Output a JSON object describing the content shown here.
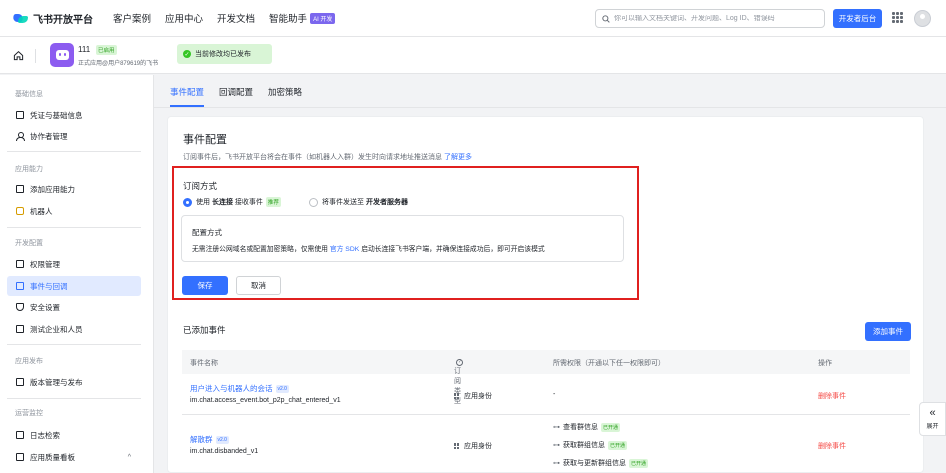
{
  "topbar": {
    "logo_text": "飞书开放平台",
    "nav": [
      "客户案例",
      "应用中心",
      "开发文档",
      "智能助手"
    ],
    "ai_badge": "AI 开发",
    "search_placeholder": "你可以输入文档关键词、开发问题、Log ID、错误码",
    "dev_console": "开发者后台",
    "icons": [
      "logo-icon",
      "search-icon",
      "apps-grid-icon",
      "user-avatar"
    ]
  },
  "appbar": {
    "app_name": "111",
    "app_status": "已启用",
    "app_sub": "正式应用@用户879619的飞书",
    "published_text": "当前修改均已发布"
  },
  "sidebar": {
    "groups": [
      {
        "title": "基础信息",
        "items": [
          "凭证与基础信息",
          "协作者管理"
        ]
      },
      {
        "title": "应用能力",
        "items": [
          "添加应用能力",
          "机器人"
        ]
      },
      {
        "title": "开发配置",
        "items": [
          "权限管理",
          "事件与回调",
          "安全设置",
          "测试企业和人员"
        ]
      },
      {
        "title": "应用发布",
        "items": [
          "版本管理与发布"
        ]
      },
      {
        "title": "运营监控",
        "items": [
          "日志检索",
          "应用质量看板"
        ]
      }
    ],
    "active": "事件与回调"
  },
  "tabs": [
    "事件配置",
    "回调配置",
    "加密策略"
  ],
  "event_config": {
    "title": "事件配置",
    "desc": "订阅事件后，飞书开放平台将会在事件（如机器人入群）发生时向请求地址推送消息",
    "learn_more": "了解更多",
    "subscribe_title": "订阅方式",
    "option1_pre": "使用",
    "option1_bold": "长连接",
    "option1_post": "接收事件",
    "recommended": "推荐",
    "option2_pre": "将事件发送至",
    "option2_bold": "开发者服务器",
    "mode_title": "配置方式",
    "mode_desc_pre": "无需注册公网域名或配置加密策略，仅需使用",
    "mode_desc_link": "官方 SDK",
    "mode_desc_post": "启动长连接飞书客户端，并确保连接成功后，即可开启该模式",
    "save": "保存",
    "cancel": "取消"
  },
  "added_events": {
    "title": "已添加事件",
    "add_button": "添加事件",
    "columns": [
      "事件名称",
      "订阅类型",
      "所需权限（开通以下任一权限即可）",
      "操作"
    ],
    "rows": [
      {
        "name": "用户进入与机器人的会话",
        "version": "v2.0",
        "code": "im.chat.access_event.bot_p2p_chat_entered_v1",
        "sub_type": "应用身份",
        "perms": [
          {
            "text": "-",
            "badge": ""
          }
        ],
        "action": "删除事件"
      },
      {
        "name": "解散群",
        "version": "v2.0",
        "code": "im.chat.disbanded_v1",
        "sub_type": "应用身份",
        "perms": [
          {
            "text": "查看群信息",
            "badge": "已开通"
          },
          {
            "text": "获取群组信息",
            "badge": "已开通"
          },
          {
            "text": "获取与更新群组信息",
            "badge": "已开通"
          }
        ],
        "action": "删除事件"
      }
    ]
  },
  "float_button": "展开"
}
